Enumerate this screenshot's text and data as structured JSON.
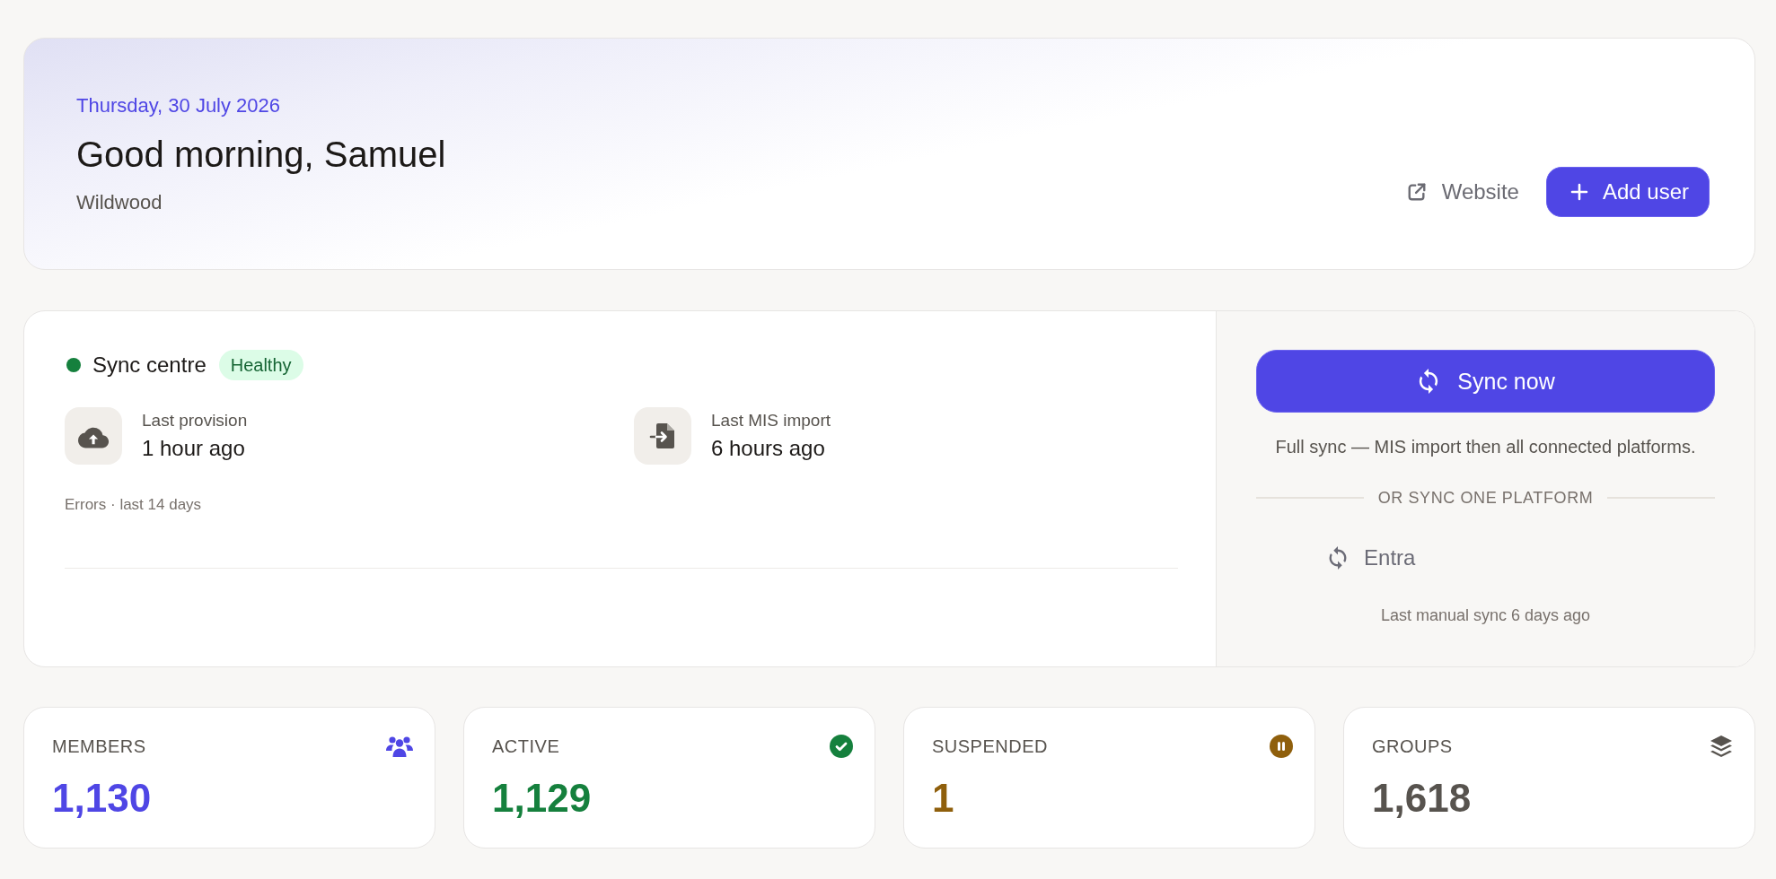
{
  "header": {
    "date": "Thursday, 30 July 2026",
    "greeting": "Good morning, Samuel",
    "organisation": "Wildwood",
    "actions": [
      {
        "kind": "link",
        "label": "Website"
      },
      {
        "kind": "primary",
        "label": "Add user"
      }
    ]
  },
  "sync_centre": {
    "title": "Sync centre",
    "status": {
      "kind": "healthy",
      "label": "Healthy"
    },
    "last_runs": [
      {
        "kind": "provision",
        "label": "Last provision",
        "value": "1 hour ago"
      },
      {
        "kind": "import",
        "label": "Last MIS import",
        "value": "6 hours ago"
      }
    ],
    "errors_chart": {
      "title": "Errors · last 14 days"
    },
    "sync_button": "Sync now",
    "description": "Full sync — MIS import then all connected platforms.",
    "divider_label": "OR SYNC ONE PLATFORM",
    "platforms": [
      {
        "name": "Entra"
      }
    ],
    "platform_note": "Last manual sync 6 days ago"
  },
  "stats": [
    {
      "kind": "members",
      "label": "MEMBERS",
      "value": "1,130",
      "color": "#4f46e5"
    },
    {
      "kind": "active",
      "label": "ACTIVE",
      "value": "1,129",
      "color": "#15803d"
    },
    {
      "kind": "suspended",
      "label": "SUSPENDED",
      "value": "1",
      "color": "#8f5f0c"
    },
    {
      "kind": "groups",
      "label": "GROUPS",
      "value": "1,618",
      "color": "#57534e"
    }
  ]
}
